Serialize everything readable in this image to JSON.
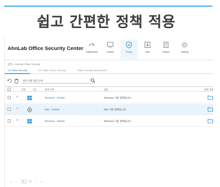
{
  "headline": "쉽고 간편한 정책 적용",
  "app": {
    "title": "AhnLab Office Security Center",
    "nav": [
      {
        "label": "Dashboard",
        "icon": "gauge-icon"
      },
      {
        "label": "Device",
        "icon": "monitor-icon"
      },
      {
        "label": "Policy",
        "icon": "shield-check-icon"
      },
      {
        "label": "Jobs",
        "icon": "download-icon"
      },
      {
        "label": "Report",
        "icon": "report-icon"
      },
      {
        "label": "Setting",
        "icon": "gear-icon"
      }
    ],
    "active_nav": "Policy"
  },
  "breadcrumb": "정책 > AhnLab Office Security",
  "tabs": [
    {
      "label": "V3 Office Security"
    },
    {
      "label": "V3 Office Server Security"
    },
    {
      "label": "Office Security Assessment"
    }
  ],
  "toolbar": {
    "search_placeholder": "정책 이름 설정 검색"
  },
  "table": {
    "columns": [
      "",
      "",
      "유형",
      "구분",
      "정책 이름",
      "설명",
      "정책 적용"
    ],
    "rows": [
      {
        "pin": "✕",
        "icon": "windows-icon",
        "name": "Windows - Default",
        "description": "Windows 기본 정책입니다.",
        "selected": false
      },
      {
        "pin": "✕",
        "icon": "apple-icon",
        "name": "Mac - Default",
        "description": "Mac 기본 정책입니다.",
        "selected": true
      },
      {
        "pin": "✕",
        "icon": "windows-icon",
        "name": "Windows - Default",
        "description": "Windows 기본 정책입니다.",
        "selected": false
      }
    ]
  },
  "pagination": {
    "first": "«",
    "prev": "‹",
    "current_page": "1",
    "total": "/ 1",
    "next": "›",
    "last": "»"
  },
  "colors": {
    "accent": "#1f7fc6",
    "top_accent": "#62b8e8",
    "row_selected": "#e9f3fb",
    "folder": "#2e8fd6"
  }
}
